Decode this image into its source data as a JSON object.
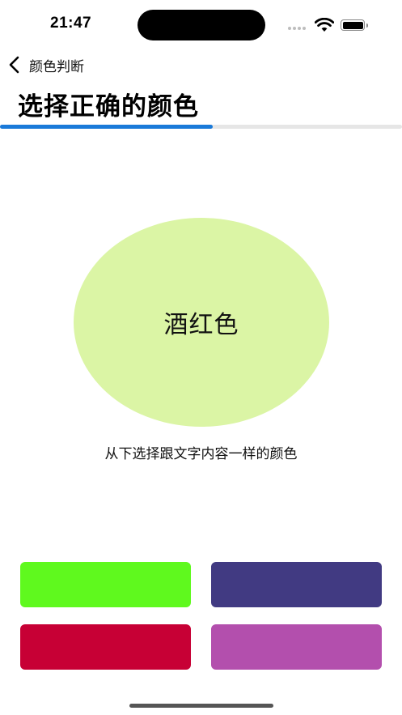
{
  "status_bar": {
    "time": "21:47",
    "signal_icon": "cellular-signal-icon",
    "wifi_icon": "wifi-icon",
    "battery_icon": "battery-icon",
    "battery_level": 1.0
  },
  "nav": {
    "back_icon": "chevron-left-icon",
    "back_label": "颜色判断"
  },
  "page": {
    "title": "选择正确的颜色",
    "progress": 0.53,
    "progress_color": "#1a7ad9"
  },
  "prompt": {
    "word": "酒红色",
    "circle_color": "#dbf5a5",
    "word_color": "#111111",
    "instruction": "从下选择跟文字内容一样的颜色"
  },
  "choices": [
    {
      "color": "#5ff91e"
    },
    {
      "color": "#413a82"
    },
    {
      "color": "#c70035"
    },
    {
      "color": "#b34fad"
    }
  ]
}
